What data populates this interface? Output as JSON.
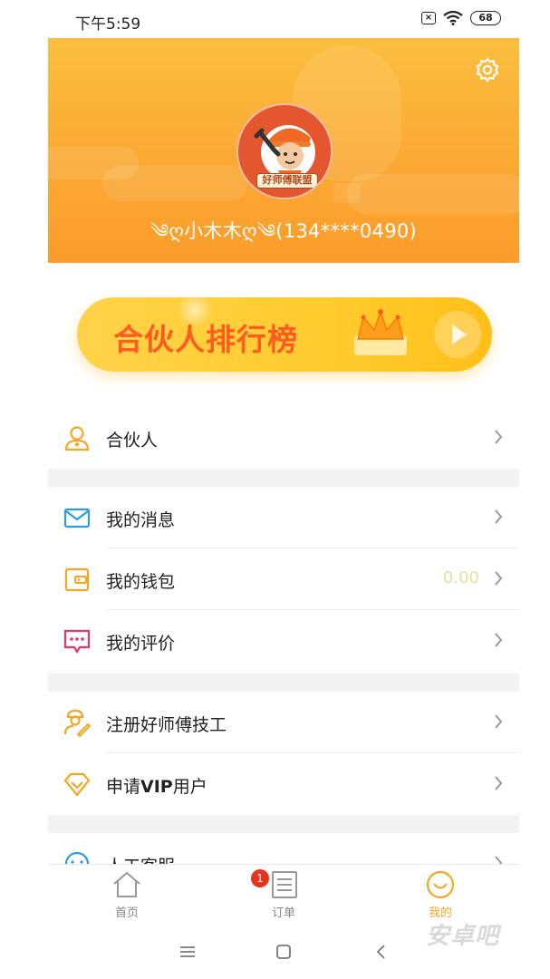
{
  "status_bar": {
    "time": "下午5:59",
    "battery": "68"
  },
  "header": {
    "avatar_badge": "好师傅联盟",
    "username": "༄ღ小木木ღ༄(134****0490)"
  },
  "banner": {
    "title": "合伙人排行榜"
  },
  "menu": {
    "partner": "合伙人",
    "messages": "我的消息",
    "wallet": "我的钱包",
    "wallet_value": "0.00",
    "reviews": "我的评价",
    "register": "注册好师傅技工",
    "vip_prefix": "申请",
    "vip_bold": "VIP",
    "vip_suffix": "用户",
    "support": "人工客服"
  },
  "tabs": {
    "home": "首页",
    "orders": "订单",
    "orders_badge": "1",
    "mine": "我的"
  },
  "watermark": "安卓吧",
  "colors": {
    "header_gradient_top": "#fbbf3f",
    "header_gradient_bottom": "#fb9c2b",
    "active_tab": "#f5a623",
    "badge": "#e8321c",
    "banner_text": "#ff5a1f"
  },
  "icons": {
    "settings": "gear-icon",
    "partner": "person-icon",
    "messages": "envelope-icon",
    "wallet": "wallet-icon",
    "reviews": "chat-bubble-icon",
    "register": "worker-icon",
    "vip": "diamond-icon",
    "support": "headset-icon"
  }
}
